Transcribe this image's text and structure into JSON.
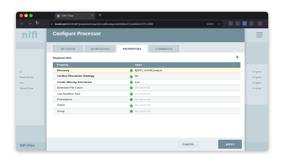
{
  "browser": {
    "tab_title": "NiFi Flow",
    "new_tab": "+",
    "url_host": "localhost",
    "url_rest": ":8443/nifi/?processGroupId=root&componentIds=e7c1a3d6-0179-1000",
    "zoom": "110%",
    "nav": {
      "back": "←",
      "forward": "→",
      "reload": "↻"
    },
    "colors": {
      "close": "#fe5f57",
      "minimize": "#febc2e",
      "maximize": "#28c840"
    }
  },
  "app": {
    "logo": "nifi",
    "footer_label": "NiFi Flow",
    "background_labels": [
      "In",
      "Read/Write",
      "Out",
      "Tasks/Time"
    ],
    "background_values": [
      "0 bytes",
      "0 bytes",
      "0 bytes",
      "0 bytes"
    ]
  },
  "dialog": {
    "title": "Configure Processor",
    "tabs": [
      "SETTINGS",
      "SCHEDULING",
      "PROPERTIES",
      "COMMENTS"
    ],
    "active_tab": "PROPERTIES",
    "required_field_label": "Required field",
    "add_property_icon": "plus-icon",
    "columns": {
      "property": "Property",
      "value": "Value"
    },
    "properties": [
      {
        "name": "Directory",
        "value": "${NIFI_HOME}/output",
        "required": true,
        "set": true
      },
      {
        "name": "Conflict Resolution Strategy",
        "value": "fail",
        "required": true,
        "set": true
      },
      {
        "name": "Create Missing Directories",
        "value": "true",
        "required": true,
        "set": true
      },
      {
        "name": "Maximum File Count",
        "value": "No value set",
        "required": false,
        "set": false
      },
      {
        "name": "Last Modified Time",
        "value": "No value set",
        "required": false,
        "set": false
      },
      {
        "name": "Permissions",
        "value": "No value set",
        "required": false,
        "set": false
      },
      {
        "name": "Owner",
        "value": "No value set",
        "required": false,
        "set": false
      },
      {
        "name": "Group",
        "value": "No value set",
        "required": false,
        "set": false
      }
    ],
    "buttons": {
      "cancel": "CANCEL",
      "apply": "APPLY"
    }
  }
}
